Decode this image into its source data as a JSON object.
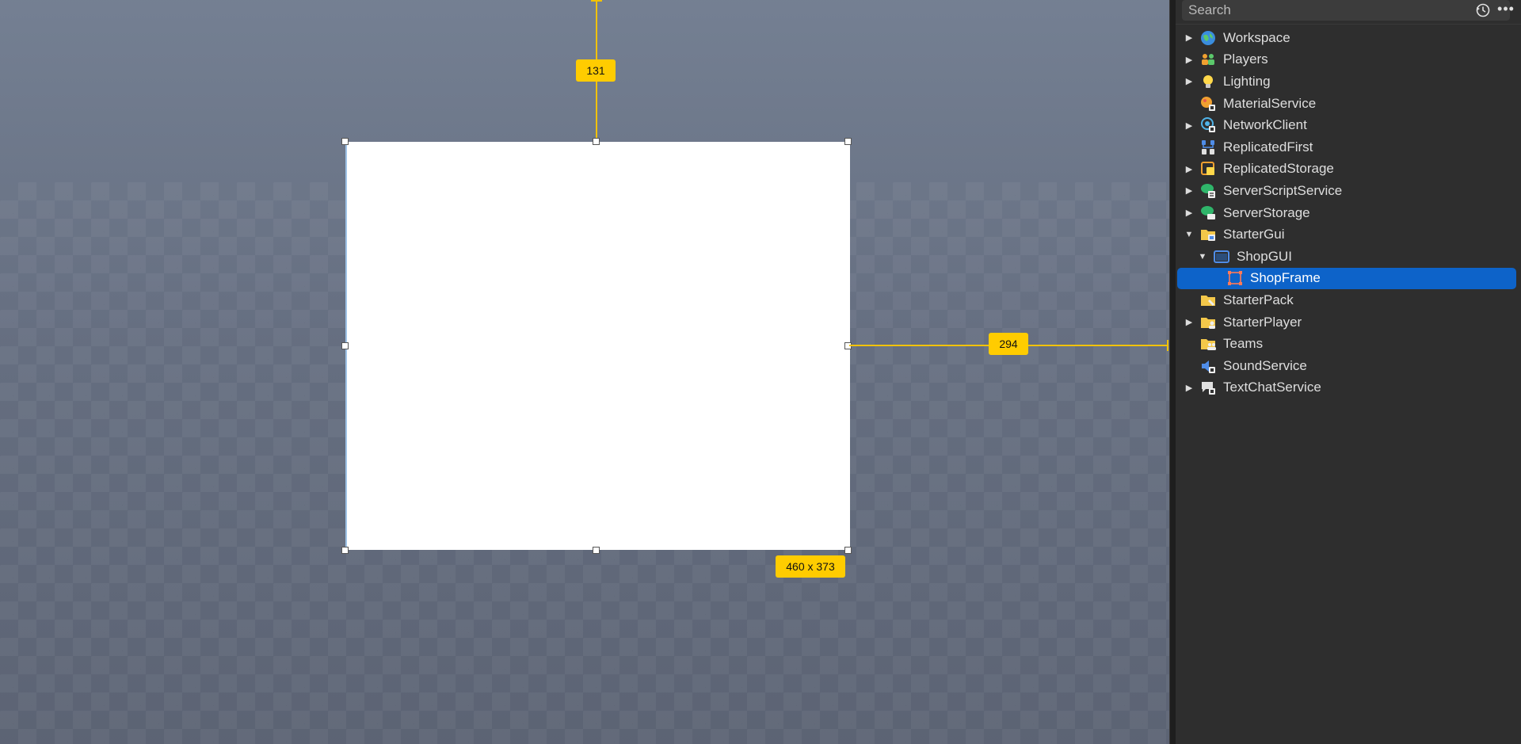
{
  "viewport": {
    "measure_top": "131",
    "measure_right": "294",
    "measure_size": "460 x 373"
  },
  "explorer": {
    "search_placeholder": "Search",
    "more_label": "•••",
    "items": [
      {
        "label": "Workspace",
        "icon": "workspace-globe-icon",
        "depth": 0,
        "arrow": "collapsed"
      },
      {
        "label": "Players",
        "icon": "players-icon",
        "depth": 0,
        "arrow": "collapsed"
      },
      {
        "label": "Lighting",
        "icon": "lightbulb-icon",
        "depth": 0,
        "arrow": "collapsed"
      },
      {
        "label": "MaterialService",
        "icon": "material-service-icon",
        "depth": 0,
        "arrow": "none"
      },
      {
        "label": "NetworkClient",
        "icon": "network-client-icon",
        "depth": 0,
        "arrow": "collapsed"
      },
      {
        "label": "ReplicatedFirst",
        "icon": "replicated-first-icon",
        "depth": 0,
        "arrow": "none"
      },
      {
        "label": "ReplicatedStorage",
        "icon": "replicated-storage-icon",
        "depth": 0,
        "arrow": "collapsed"
      },
      {
        "label": "ServerScriptService",
        "icon": "server-script-service-icon",
        "depth": 0,
        "arrow": "collapsed"
      },
      {
        "label": "ServerStorage",
        "icon": "server-storage-icon",
        "depth": 0,
        "arrow": "collapsed"
      },
      {
        "label": "StarterGui",
        "icon": "starter-gui-folder-icon",
        "depth": 0,
        "arrow": "expanded"
      },
      {
        "label": "ShopGUI",
        "icon": "screen-gui-icon",
        "depth": 1,
        "arrow": "expanded"
      },
      {
        "label": "ShopFrame",
        "icon": "frame-icon",
        "depth": 2,
        "arrow": "none",
        "selected": true
      },
      {
        "label": "StarterPack",
        "icon": "starter-pack-folder-icon",
        "depth": 0,
        "arrow": "none"
      },
      {
        "label": "StarterPlayer",
        "icon": "starter-player-folder-icon",
        "depth": 0,
        "arrow": "collapsed"
      },
      {
        "label": "Teams",
        "icon": "teams-folder-icon",
        "depth": 0,
        "arrow": "none"
      },
      {
        "label": "SoundService",
        "icon": "sound-service-icon",
        "depth": 0,
        "arrow": "none"
      },
      {
        "label": "TextChatService",
        "icon": "text-chat-service-icon",
        "depth": 0,
        "arrow": "collapsed"
      }
    ]
  },
  "colors": {
    "selection": "#0d63c9",
    "guide": "#f2c200",
    "measure_bg": "#ffcc00"
  }
}
